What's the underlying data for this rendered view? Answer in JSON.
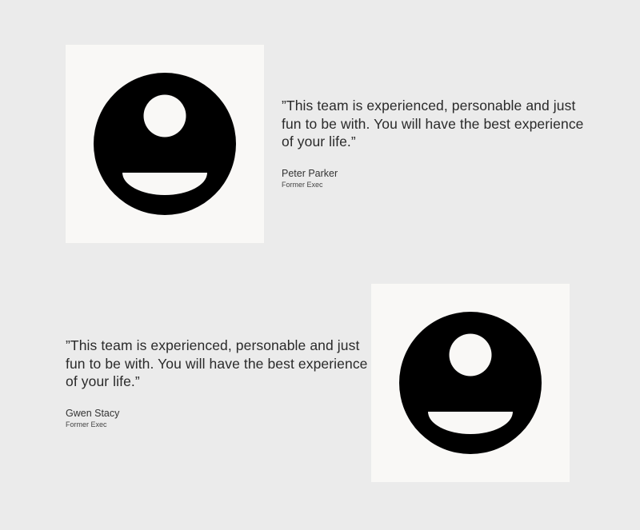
{
  "colors": {
    "background": "#ebebeb",
    "card": "#f9f8f6",
    "icon": "#000000",
    "text": "#2a2a2a"
  },
  "testimonials": [
    {
      "quote": "”This team is experienced, personable and just fun to be with. You will have the best experience of your life.”",
      "name": "Peter Parker",
      "role": "Former Exec",
      "icon": "user-avatar-icon"
    },
    {
      "quote": "”This team is experienced, personable and just fun to be with. You will have the best experience of your life.”",
      "name": "Gwen Stacy",
      "role": "Former Exec",
      "icon": "user-avatar-icon"
    }
  ]
}
